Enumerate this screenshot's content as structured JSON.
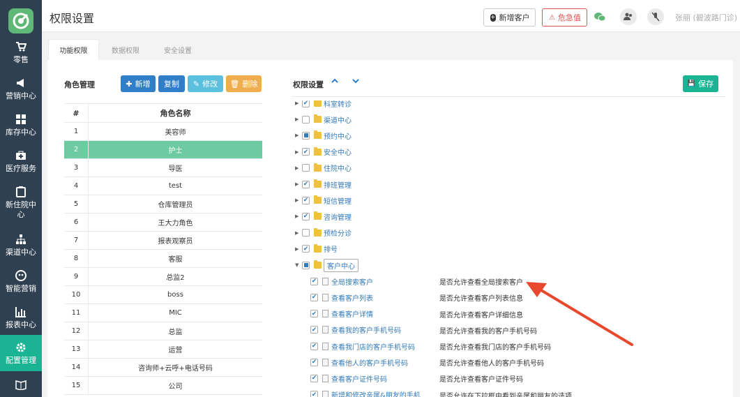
{
  "header": {
    "title": "权限设置",
    "new_customer": "新增客户",
    "crisis": "危急值",
    "user": "张丽 (碧波路门诊)"
  },
  "sidebar": {
    "items": [
      {
        "label": "零售",
        "icon": "cart-icon"
      },
      {
        "label": "营销中心",
        "icon": "megaphone-icon"
      },
      {
        "label": "库存中心",
        "icon": "grid-icon"
      },
      {
        "label": "医疗服务",
        "icon": "medkit-icon"
      },
      {
        "label": "新住院中心",
        "icon": "clipboard-icon"
      },
      {
        "label": "渠道中心",
        "icon": "sitemap-icon"
      },
      {
        "label": "智能营销",
        "icon": "robot-icon"
      },
      {
        "label": "报表中心",
        "icon": "bar-chart-icon"
      },
      {
        "label": "配置管理",
        "icon": "gear-icon"
      },
      {
        "label": "",
        "icon": "book-icon"
      }
    ]
  },
  "tabs": [
    "功能权限",
    "数据权限",
    "安全设置"
  ],
  "roles": {
    "title": "角色管理",
    "buttons": {
      "add": "新增",
      "copy": "复制",
      "edit": "修改",
      "delete": "删除"
    },
    "columns": [
      "#",
      "角色名称"
    ],
    "rows": [
      {
        "id": "1",
        "name": "美容师"
      },
      {
        "id": "2",
        "name": "护士"
      },
      {
        "id": "3",
        "name": "导医"
      },
      {
        "id": "4",
        "name": "test"
      },
      {
        "id": "5",
        "name": "仓库管理员"
      },
      {
        "id": "6",
        "name": "王大力角色"
      },
      {
        "id": "7",
        "name": "报表观察员"
      },
      {
        "id": "8",
        "name": "客服"
      },
      {
        "id": "9",
        "name": "总监2"
      },
      {
        "id": "10",
        "name": "boss"
      },
      {
        "id": "11",
        "name": "MIC"
      },
      {
        "id": "12",
        "name": "总监"
      },
      {
        "id": "13",
        "name": "运营"
      },
      {
        "id": "14",
        "name": "咨询师+云呼+电话号码"
      },
      {
        "id": "15",
        "name": "公司"
      }
    ],
    "selected_id": "2"
  },
  "perms": {
    "title": "权限设置",
    "save": "保存",
    "groups": [
      {
        "label": "科室转诊",
        "state": "checked"
      },
      {
        "label": "渠道中心",
        "state": "unchecked"
      },
      {
        "label": "预约中心",
        "state": "partial"
      },
      {
        "label": "安全中心",
        "state": "checked"
      },
      {
        "label": "住院中心",
        "state": "unchecked"
      },
      {
        "label": "排班管理",
        "state": "checked"
      },
      {
        "label": "短信管理",
        "state": "checked"
      },
      {
        "label": "咨询管理",
        "state": "checked"
      },
      {
        "label": "预检分诊",
        "state": "unchecked"
      },
      {
        "label": "排号",
        "state": "checked"
      },
      {
        "label": "客户中心",
        "state": "partial"
      }
    ],
    "children": [
      {
        "label": "全局搜索客户",
        "desc": "是否允许查看全局搜索客户"
      },
      {
        "label": "查看客户列表",
        "desc": "是否允许查看客户列表信息"
      },
      {
        "label": "查看客户详情",
        "desc": "是否允许查看客户详细信息"
      },
      {
        "label": "查看我的客户手机号码",
        "desc": "是否允许查看我的客户手机号码"
      },
      {
        "label": "查看我门店的客户手机号码",
        "desc": "是否允许查看我门店的客户手机号码"
      },
      {
        "label": "查看他人的客户手机号码",
        "desc": "是否允许查看他人的客户手机号码"
      },
      {
        "label": "查看客户证件号码",
        "desc": "是否允许查看客户证件号码"
      },
      {
        "label": "新增和修改亲属&朋友的手机",
        "desc": "是否允许在下拉框中看到亲属和朋友的选项"
      }
    ]
  },
  "colors": {
    "sidebar": "#2f4050",
    "active": "#1ab394",
    "primary": "#2f7ec7",
    "warning": "#f0ad4e",
    "info": "#5bc0de",
    "arrow": "#e8482e"
  }
}
